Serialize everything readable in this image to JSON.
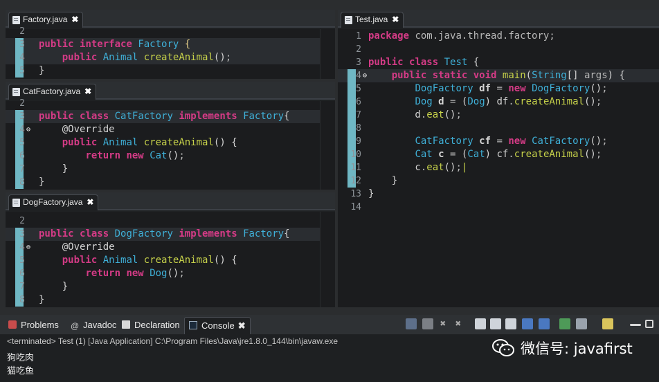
{
  "factory_editor": {
    "tab": "Factory.java",
    "lines": [
      {
        "n": "2",
        "html": ""
      },
      {
        "n": "3",
        "html": "<span class=\"k\">public</span> <span class=\"k\">interface</span> <span class=\"t\">Factory</span> <span class=\"o\">{</span>"
      },
      {
        "n": "4",
        "html": "    <span class=\"k\">public</span> <span class=\"t\">Animal</span> <span class=\"f\">createAnimal</span>()<span class=\"a\">;</span>"
      },
      {
        "n": "5",
        "html": "}"
      }
    ]
  },
  "catfactory_editor": {
    "tab": "CatFactory.java",
    "lines": [
      {
        "n": "2",
        "html": ""
      },
      {
        "n": "3",
        "html": "<span class=\"k\">public</span> <span class=\"k\">class</span> <span class=\"t\">CatFactory</span> <span class=\"k\">implements</span> <span class=\"t\">Factory</span>{"
      },
      {
        "n": "4",
        "html": "    @Override"
      },
      {
        "n": "5",
        "html": "    <span class=\"k\">public</span> <span class=\"t\">Animal</span> <span class=\"f\">createAnimal</span>() {"
      },
      {
        "n": "6",
        "html": "        <span class=\"k\">return</span> <span class=\"k\">new</span> <span class=\"t\">Cat</span>()<span class=\"a\">;</span>"
      },
      {
        "n": "7",
        "html": "    }"
      },
      {
        "n": "8",
        "html": "}"
      }
    ]
  },
  "dogfactory_editor": {
    "tab": "DogFactory.java",
    "lines": [
      {
        "n": "2",
        "html": ""
      },
      {
        "n": "3",
        "html": "<span class=\"k\">public</span> <span class=\"k\">class</span> <span class=\"t\">DogFactory</span> <span class=\"k\">implements</span> <span class=\"t\">Factory</span>{"
      },
      {
        "n": "4",
        "html": "    @Override"
      },
      {
        "n": "5",
        "html": "    <span class=\"k\">public</span> <span class=\"t\">Animal</span> <span class=\"f\">createAnimal</span>() {"
      },
      {
        "n": "6",
        "html": "        <span class=\"k\">return</span> <span class=\"k\">new</span> <span class=\"t\">Dog</span>()<span class=\"a\">;</span>"
      },
      {
        "n": "7",
        "html": "    }"
      },
      {
        "n": "8",
        "html": "}"
      }
    ]
  },
  "test_editor": {
    "tab": "Test.java",
    "lines": [
      {
        "n": "1",
        "html": "<span class=\"k\">package</span> <span class=\"a\">com.java.thread.factory;</span>"
      },
      {
        "n": "2",
        "html": ""
      },
      {
        "n": "3",
        "html": "<span class=\"k\">public</span> <span class=\"k\">class</span> <span class=\"t\">Test</span> {"
      },
      {
        "n": "4",
        "html": "    <span class=\"k\">public</span> <span class=\"k\">static</span> <span class=\"k\">void</span> <span class=\"f\">main</span>(<span class=\"t\">String</span>[] <span class=\"a\">args</span>) {"
      },
      {
        "n": "5",
        "html": "        <span class=\"t\">DogFactory</span> <b>df</b> <span class=\"a\">=</span> <span class=\"k\">new</span> <span class=\"t\">DogFactory</span>()<span class=\"a\">;</span>"
      },
      {
        "n": "6",
        "html": "        <span class=\"t\">Dog</span> <b>d</b> <span class=\"a\">=</span> (<span class=\"t\">Dog</span>) df<span class=\"a\">.</span><span class=\"f\">createAnimal</span>()<span class=\"a\">;</span>"
      },
      {
        "n": "7",
        "html": "        d<span class=\"a\">.</span><span class=\"f\">eat</span>()<span class=\"a\">;</span>"
      },
      {
        "n": "8",
        "html": ""
      },
      {
        "n": "9",
        "html": "        <span class=\"t\">CatFactory</span> <b>cf</b> <span class=\"a\">=</span> <span class=\"k\">new</span> <span class=\"t\">CatFactory</span>()<span class=\"a\">;</span>"
      },
      {
        "n": "10",
        "html": "        <span class=\"t\">Cat</span> <b>c</b> <span class=\"a\">=</span> (<span class=\"t\">Cat</span>) cf<span class=\"a\">.</span><span class=\"f\">createAnimal</span>()<span class=\"a\">;</span>"
      },
      {
        "n": "11",
        "html": "        c<span class=\"a\">.</span><span class=\"f\">eat</span>()<span class=\"a\">;</span><span style=\"color:#c6d14a\">|</span>"
      },
      {
        "n": "12",
        "html": "    }"
      },
      {
        "n": "13",
        "html": "}"
      },
      {
        "n": "14",
        "html": ""
      }
    ]
  },
  "console": {
    "tabs": {
      "problems": "Problems",
      "javadoc": "Javadoc",
      "declaration": "Declaration",
      "console": "Console"
    },
    "status": "<terminated> Test (1) [Java Application] C:\\Program Files\\Java\\jre1.8.0_144\\bin\\javaw.exe",
    "output": [
      "狗吃肉",
      "猫吃鱼"
    ]
  },
  "watermark": "微信号: javafirst",
  "colors": {
    "keyword": "#d43b86",
    "type": "#3fb0d8",
    "method": "#c6d14a",
    "quick_diff": "#6fb7c4"
  }
}
